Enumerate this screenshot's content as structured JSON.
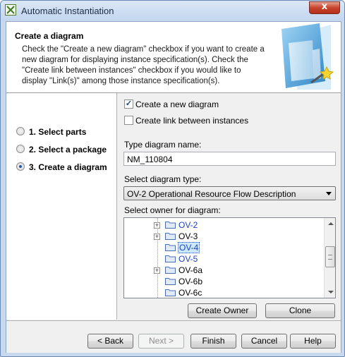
{
  "window": {
    "title": "Automatic Instantiation",
    "close_glyph": "x"
  },
  "header": {
    "title": "Create a diagram",
    "description": "Check the \"Create a new diagram\" checkbox if you want to create a new diagram for displaying instance specification(s). Check the \"Create link between instances\" checkbox if you would like to display \"Link(s)\" among those instance specification(s).",
    "graphic_icon": "wizard-document-icon"
  },
  "steps": [
    {
      "label": "1. Select parts",
      "selected": false
    },
    {
      "label": "2. Select a package",
      "selected": false
    },
    {
      "label": "3. Create a diagram",
      "selected": true
    }
  ],
  "options": {
    "create_new_diagram": {
      "label": "Create a new diagram",
      "checked": true
    },
    "create_link": {
      "label": "Create link between instances",
      "checked": false
    }
  },
  "diagram_name": {
    "label": "Type diagram name:",
    "value": "NM_110804"
  },
  "diagram_type": {
    "label": "Select diagram type:",
    "selected": "OV-2 Operational Resource Flow Description"
  },
  "owner": {
    "label": "Select owner for diagram:",
    "tree": [
      {
        "label": "OV-2",
        "expandable": true,
        "style": "blue"
      },
      {
        "label": "OV-3",
        "expandable": true,
        "style": "normal"
      },
      {
        "label": "OV-4",
        "expandable": false,
        "style": "selected"
      },
      {
        "label": "OV-5",
        "expandable": false,
        "style": "blue"
      },
      {
        "label": "OV-6a",
        "expandable": true,
        "style": "normal"
      },
      {
        "label": "OV-6b",
        "expandable": false,
        "style": "normal"
      },
      {
        "label": "OV-6c",
        "expandable": false,
        "style": "normal"
      }
    ],
    "create_owner_label": "Create Owner",
    "clone_label": "Clone"
  },
  "footer": {
    "back_label": "< Back",
    "next_label": "Next >",
    "finish_label": "Finish",
    "cancel_label": "Cancel",
    "help_label": "Help"
  },
  "colors": {
    "accent_blue": "#1b44c2",
    "selection_bg": "#cce8ff",
    "titlebar": "#c3d6ee",
    "close_button": "#c6442c"
  }
}
